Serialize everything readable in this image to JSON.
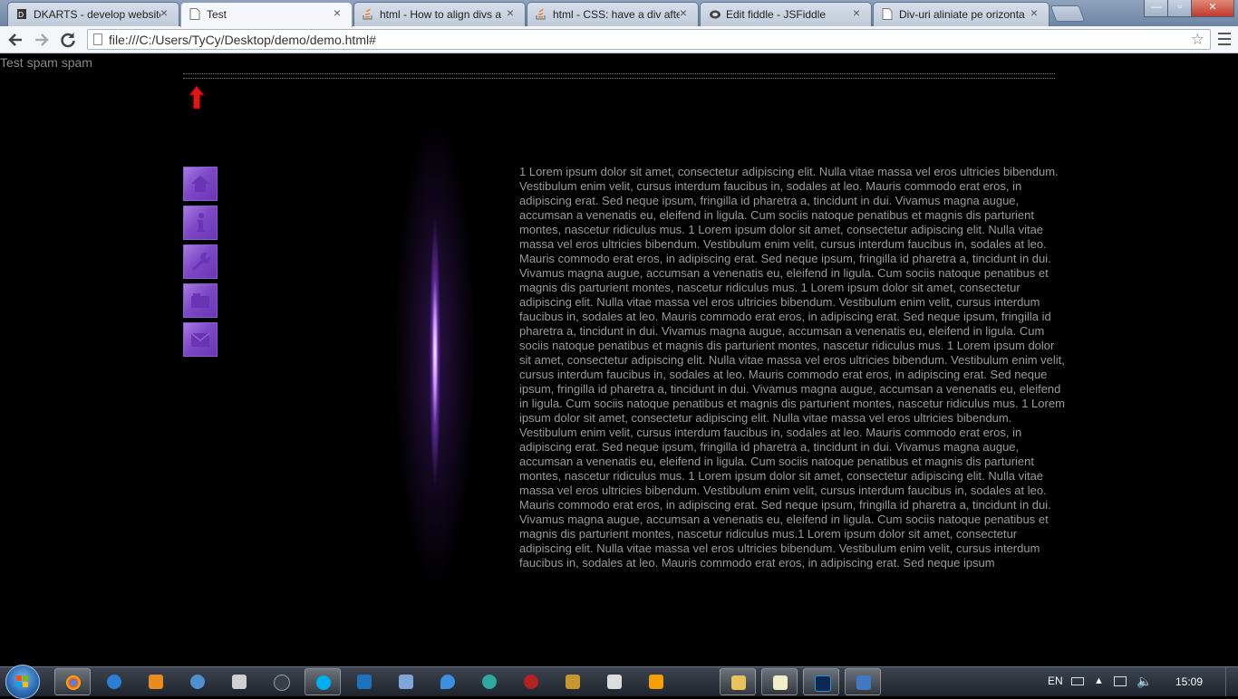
{
  "browser": {
    "tabs": [
      {
        "title": "DKARTS - develop website",
        "icon": "dk-icon",
        "active": false
      },
      {
        "title": "Test",
        "icon": "page-icon",
        "active": true
      },
      {
        "title": "html - How to align divs a",
        "icon": "stackoverflow-icon",
        "active": false
      },
      {
        "title": "html - CSS: have a div afte",
        "icon": "stackoverflow-icon",
        "active": false
      },
      {
        "title": "Edit fiddle - JSFiddle",
        "icon": "jsfiddle-icon",
        "active": false
      },
      {
        "title": "Div-uri aliniate pe orizonta",
        "icon": "page-icon",
        "active": false
      }
    ],
    "url": "file:///C:/Users/TyCy/Desktop/demo/demo.html#"
  },
  "page": {
    "top_text": "Test spam spam",
    "nav_icons": [
      "home-icon",
      "info-icon",
      "wrench-icon",
      "folder-icon",
      "mail-icon"
    ],
    "nav_color": "#7e49c7",
    "arrow_color": "#e0161b",
    "body_text": "1 Lorem ipsum dolor sit amet, consectetur adipiscing elit. Nulla vitae massa vel eros ultricies bibendum. Vestibulum enim velit, cursus interdum faucibus in, sodales at leo. Mauris commodo erat eros, in adipiscing erat. Sed neque ipsum, fringilla id pharetra a, tincidunt in dui. Vivamus magna augue, accumsan a venenatis eu, eleifend in ligula. Cum sociis natoque penatibus et magnis dis parturient montes, nascetur ridiculus mus. 1 Lorem ipsum dolor sit amet, consectetur adipiscing elit. Nulla vitae massa vel eros ultricies bibendum. Vestibulum enim velit, cursus interdum faucibus in, sodales at leo. Mauris commodo erat eros, in adipiscing erat. Sed neque ipsum, fringilla id pharetra a, tincidunt in dui. Vivamus magna augue, accumsan a venenatis eu, eleifend in ligula. Cum sociis natoque penatibus et magnis dis parturient montes, nascetur ridiculus mus. 1 Lorem ipsum dolor sit amet, consectetur adipiscing elit. Nulla vitae massa vel eros ultricies bibendum. Vestibulum enim velit, cursus interdum faucibus in, sodales at leo. Mauris commodo erat eros, in adipiscing erat. Sed neque ipsum, fringilla id pharetra a, tincidunt in dui. Vivamus magna augue, accumsan a venenatis eu, eleifend in ligula. Cum sociis natoque penatibus et magnis dis parturient montes, nascetur ridiculus mus. 1 Lorem ipsum dolor sit amet, consectetur adipiscing elit. Nulla vitae massa vel eros ultricies bibendum. Vestibulum enim velit, cursus interdum faucibus in, sodales at leo. Mauris commodo erat eros, in adipiscing erat. Sed neque ipsum, fringilla id pharetra a, tincidunt in dui. Vivamus magna augue, accumsan a venenatis eu, eleifend in ligula. Cum sociis natoque penatibus et magnis dis parturient montes, nascetur ridiculus mus. 1 Lorem ipsum dolor sit amet, consectetur adipiscing elit. Nulla vitae massa vel eros ultricies bibendum. Vestibulum enim velit, cursus interdum faucibus in, sodales at leo. Mauris commodo erat eros, in adipiscing erat. Sed neque ipsum, fringilla id pharetra a, tincidunt in dui. Vivamus magna augue, accumsan a venenatis eu, eleifend in ligula. Cum sociis natoque penatibus et magnis dis parturient montes, nascetur ridiculus mus. 1 Lorem ipsum dolor sit amet, consectetur adipiscing elit. Nulla vitae massa vel eros ultricies bibendum. Vestibulum enim velit, cursus interdum faucibus in, sodales at leo. Mauris commodo erat eros, in adipiscing erat. Sed neque ipsum, fringilla id pharetra a, tincidunt in dui. Vivamus magna augue, accumsan a venenatis eu, eleifend in ligula. Cum sociis natoque penatibus et magnis dis parturient montes, nascetur ridiculus mus.1 Lorem ipsum dolor sit amet, consectetur adipiscing elit. Nulla vitae massa vel eros ultricies bibendum. Vestibulum enim velit, cursus interdum faucibus in, sodales at leo. Mauris commodo erat eros, in adipiscing erat. Sed neque ipsum"
  },
  "taskbar": {
    "apps": [
      "chrome-icon",
      "ie-icon",
      "media-player-icon",
      "globe-icon",
      "gamepad-icon",
      "steam-icon",
      "skype-icon",
      "outlook-icon",
      "photos-icon",
      "drop-icon",
      "diablo-icon",
      "warcraft-icon",
      "counterstrike-icon",
      "office-icon",
      "explorer-icon",
      "notepad-icon",
      "photoshop-icon",
      "remote-icon"
    ],
    "language": "EN",
    "clock": "15:09"
  }
}
